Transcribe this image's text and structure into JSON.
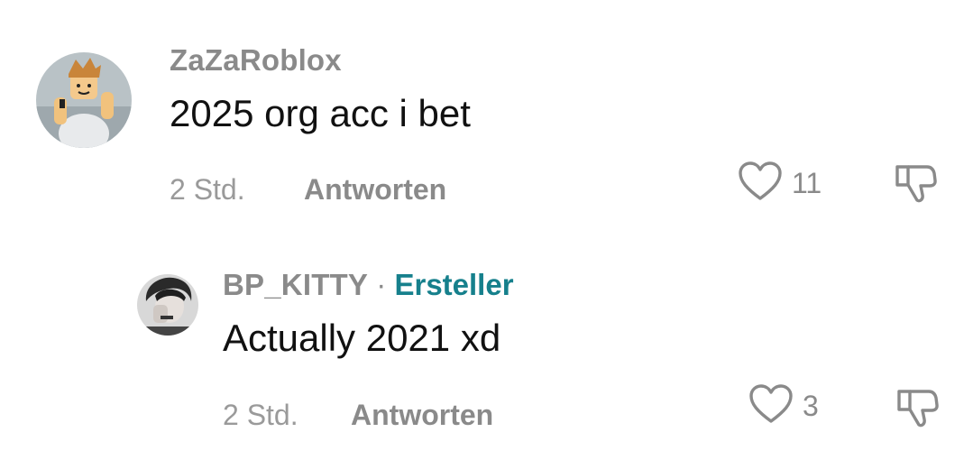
{
  "comments": [
    {
      "username": "ZaZaRoblox",
      "text": "2025 org acc i bet",
      "time": "2 Std.",
      "reply_label": "Antworten",
      "likes": "11"
    },
    {
      "username": "BP_KITTY",
      "separator": "·",
      "creator_label": "Ersteller",
      "text": "Actually 2021 xd",
      "time": "2 Std.",
      "reply_label": "Antworten",
      "likes": "3"
    }
  ],
  "colors": {
    "creator": "#16808c",
    "muted": "#8a8a8a",
    "text": "#111111"
  },
  "icons": {
    "like": "heart-outline-icon",
    "dislike": "thumbs-down-icon"
  }
}
